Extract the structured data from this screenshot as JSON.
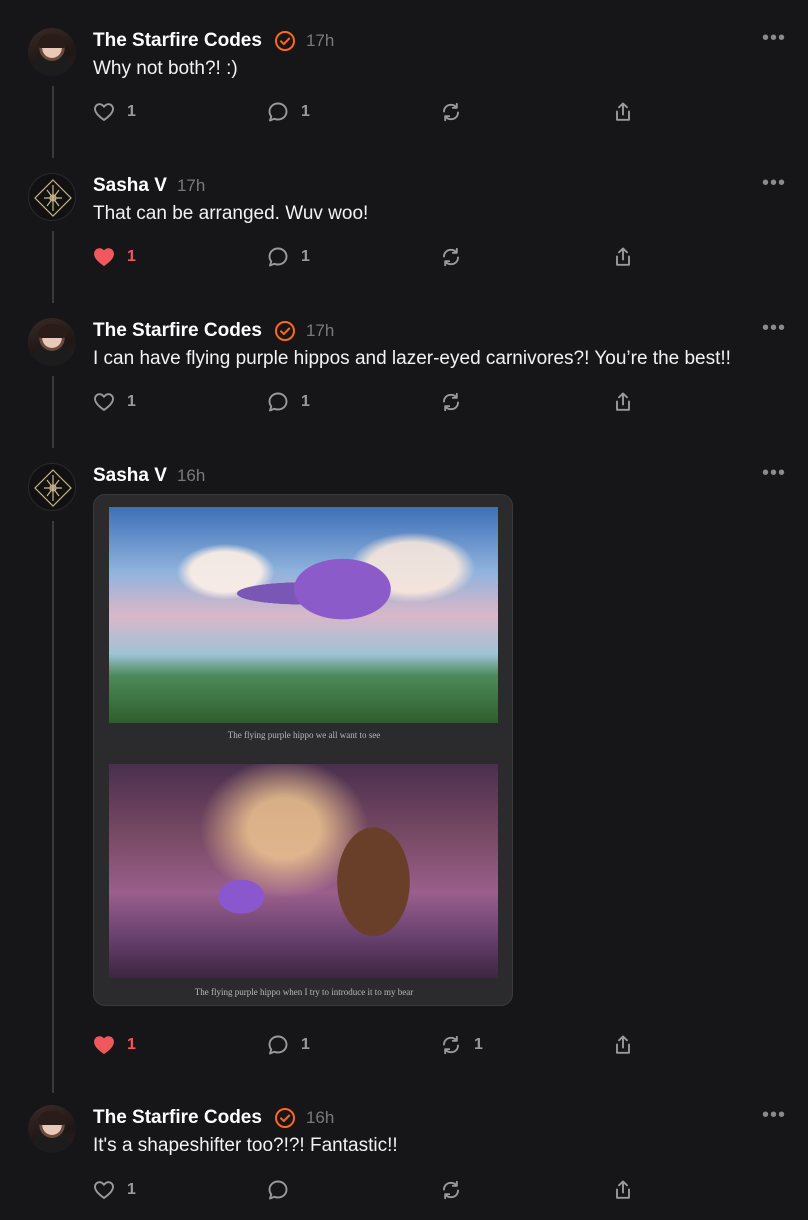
{
  "posts": [
    {
      "author": "The Starfire Codes",
      "verified": true,
      "time": "17h",
      "text": "Why not both?! :)",
      "likes": "1",
      "liked": false,
      "replies": "1",
      "restacks": "",
      "more": "•••"
    },
    {
      "author": "Sasha V",
      "verified": false,
      "time": "17h",
      "text": "That can be arranged. Wuv woo!",
      "likes": "1",
      "liked": true,
      "replies": "1",
      "restacks": "",
      "more": "•••"
    },
    {
      "author": "The Starfire Codes",
      "verified": true,
      "time": "17h",
      "text": "I can have flying purple hippos and lazer-eyed carnivores?! You’re the best!!",
      "likes": "1",
      "liked": false,
      "replies": "1",
      "restacks": "",
      "more": "•••"
    },
    {
      "author": "Sasha V",
      "verified": false,
      "time": "16h",
      "text": "",
      "images": [
        {
          "caption": "The flying purple hippo we all want to see"
        },
        {
          "caption": "The flying purple hippo when I try to introduce it to my bear"
        }
      ],
      "likes": "1",
      "liked": true,
      "replies": "1",
      "restacks": "1",
      "more": "•••"
    },
    {
      "author": "The Starfire Codes",
      "verified": true,
      "time": "16h",
      "text": "It's a shapeshifter too?!?! Fantastic!!",
      "likes": "1",
      "liked": false,
      "replies": "",
      "restacks": "",
      "more": "•••"
    }
  ],
  "icons": {
    "like": "heart-icon",
    "reply": "comment-icon",
    "restack": "restack-icon",
    "share": "share-icon",
    "verified": "verified-check-icon",
    "more": "more-options-icon"
  },
  "colors": {
    "background": "#161618",
    "liked": "#f0585e",
    "verified": "#ff6719",
    "muted": "#9a9a9e"
  }
}
